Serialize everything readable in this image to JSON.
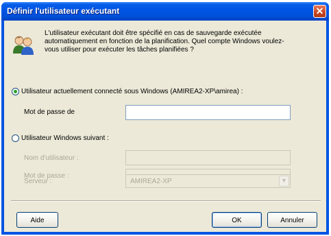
{
  "window": {
    "title": "Définir l'utilisateur exécutant"
  },
  "intro_text": "L'utilisateur exécutant doit être spécifié en cas de sauvegarde exécutée automatiquement en fonction de la planification. Quel compte Windows voulez-vous utiliser pour exécuter les tâches planifiées ?",
  "current_user": {
    "label": "Utilisateur actuellement connecté sous Windows (AMIREA2-XP\\amirea) :",
    "selected": true,
    "password_label": "Mot de passe de",
    "password_value": ""
  },
  "other_user": {
    "label": "Utilisateur Windows suivant :",
    "selected": false,
    "username_label": "Nom d'utilisateur :",
    "username_value": "",
    "password_label": "Mot de passe :",
    "password_value": "",
    "server_label": "Serveur :",
    "server_value": "AMIREA2-XP"
  },
  "buttons": {
    "help": "Aide",
    "ok": "OK",
    "cancel": "Annuler"
  },
  "icons": {
    "close": "close-icon",
    "users": "users-icon",
    "dropdown": "chevron-down-icon"
  },
  "colors": {
    "titlebar": "#0054e3",
    "dialog_bg": "#ece9d8",
    "radio_dot": "#21a121",
    "disabled_text": "#aca899"
  }
}
